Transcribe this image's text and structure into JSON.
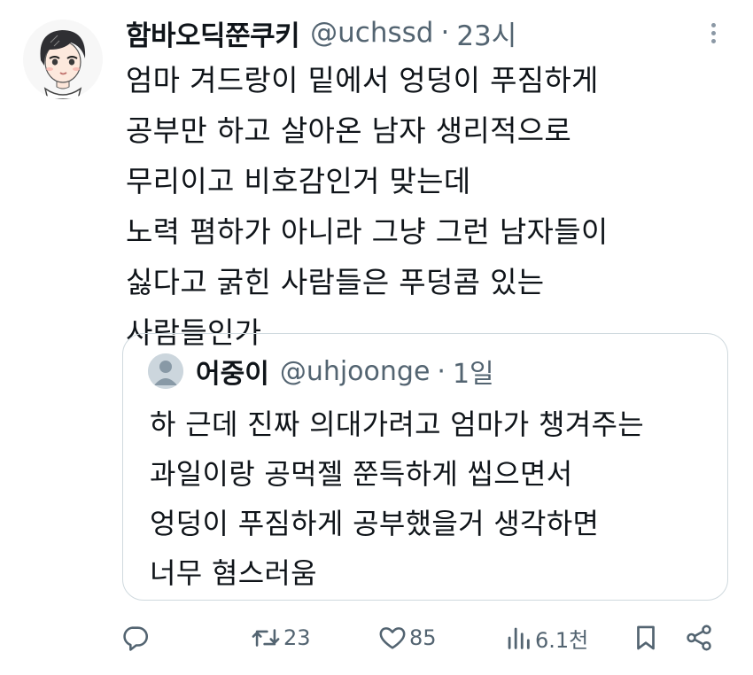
{
  "tweet": {
    "author": {
      "display_name": "함바오딕쭌쿠키",
      "handle": "@uchssd",
      "separator": "·",
      "time": "23시"
    },
    "text_lines": [
      "엄마 겨드랑이 밑에서 엉덩이 푸짐하게",
      "공부만 하고 살아온 남자 생리적으로",
      "무리이고 비호감인거 맞는데",
      "노력 폄하가 아니라 그냥 그런 남자들이",
      "싫다고 굵힌 사람들은 푸덩콤 있는",
      "사람들인가"
    ]
  },
  "quote": {
    "author": {
      "display_name": "어중이",
      "handle": "@uhjoonge",
      "separator": "·",
      "time": "1일"
    },
    "text_lines": [
      "하 근데 진짜 의대가려고 엄마가 챙겨주는",
      "과일이랑 공먹젤 쭌득하게 씹으면서",
      "엉덩이 푸짐하게 공부했을거 생각하면",
      "너무 혐스러움"
    ]
  },
  "actions": {
    "reply": {
      "icon": "reply-icon",
      "count": ""
    },
    "retweet": {
      "icon": "retweet-icon",
      "count": "23"
    },
    "like": {
      "icon": "heart-icon",
      "count": "85"
    },
    "views": {
      "icon": "views-icon",
      "count": "6.1천"
    },
    "bookmark": {
      "icon": "bookmark-icon"
    },
    "share": {
      "icon": "share-icon"
    }
  },
  "colors": {
    "text": "#0f1419",
    "secondary": "#536471",
    "border": "#cfd9de",
    "icon": "#536471"
  }
}
